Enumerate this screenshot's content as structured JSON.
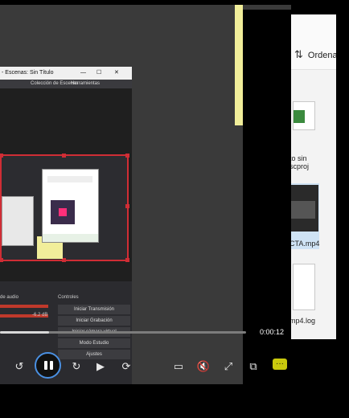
{
  "explorer": {
    "sort_label": "Ordenar",
    "files": [
      {
        "name_line1": "to sin",
        "name_line2": "scproj"
      },
      {
        "name": "CTA.mp4"
      },
      {
        "name": "mp4.log"
      }
    ]
  },
  "obs": {
    "title": "- Escenas: Sin Título",
    "menu_items": [
      "Colección de Escenas",
      "Herramientas"
    ],
    "audio_panel_label": "de audio",
    "controls_label": "Controles",
    "db_value": "-6.2 dB",
    "controls_buttons": [
      "Iniciar Transmisión",
      "Iniciar Grabación",
      "Iniciar cámara virtual",
      "Modo Estudio",
      "Ajustes"
    ]
  },
  "player": {
    "time_display": "0:00:12",
    "progress": 0.2
  },
  "colors": {
    "accent": "#4a90e2",
    "selection_red": "#d02d35",
    "cursor_highlight": "#c9c90d"
  }
}
